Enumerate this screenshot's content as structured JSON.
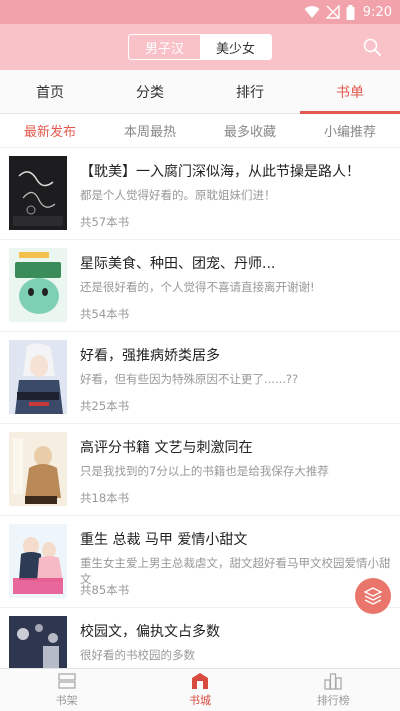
{
  "status": {
    "time": "9:20"
  },
  "header": {
    "segments": [
      {
        "label": "男子汉",
        "active": false
      },
      {
        "label": "美少女",
        "active": true
      }
    ]
  },
  "tabs": [
    {
      "label": "首页"
    },
    {
      "label": "分类"
    },
    {
      "label": "排行"
    },
    {
      "label": "书单"
    }
  ],
  "subtabs": [
    {
      "label": "最新发布"
    },
    {
      "label": "本周最热"
    },
    {
      "label": "最多收藏"
    },
    {
      "label": "小编推荐"
    }
  ],
  "booklists": [
    {
      "title": "【耽美】一入腐门深似海，从此节操是路人！",
      "desc": "都是个人觉得好看的。原耽姐妹们进！",
      "count": "共57本书"
    },
    {
      "title": "星际美食、种田、团宠、丹师...",
      "desc": "还是很好看的，个人觉得不喜请直接离开谢谢!",
      "count": "共54本书"
    },
    {
      "title": "好看，强推病娇类居多",
      "desc": "好看，但有些因为特殊原因不让更了......??",
      "count": "共25本书"
    },
    {
      "title": "高评分书籍 文艺与刺激同在",
      "desc": "只是我找到的7分以上的书籍也是给我保存大推荐",
      "count": "共18本书"
    },
    {
      "title": "重生 总裁 马甲 爱情小甜文",
      "desc": "重生女主爱上男主总裁虐文，甜文超好看马甲文校园爱情小甜文",
      "count": "共85本书"
    },
    {
      "title": "校园文，偏执文占多数",
      "desc": "很好看的书校园的多数",
      "count": ""
    }
  ],
  "bottom_nav": [
    {
      "label": "书架"
    },
    {
      "label": "书城"
    },
    {
      "label": "排行榜"
    }
  ],
  "colors": {
    "accent": "#e25a4f",
    "header": "#f8c2c8",
    "statusbar": "#f2a2ab"
  }
}
